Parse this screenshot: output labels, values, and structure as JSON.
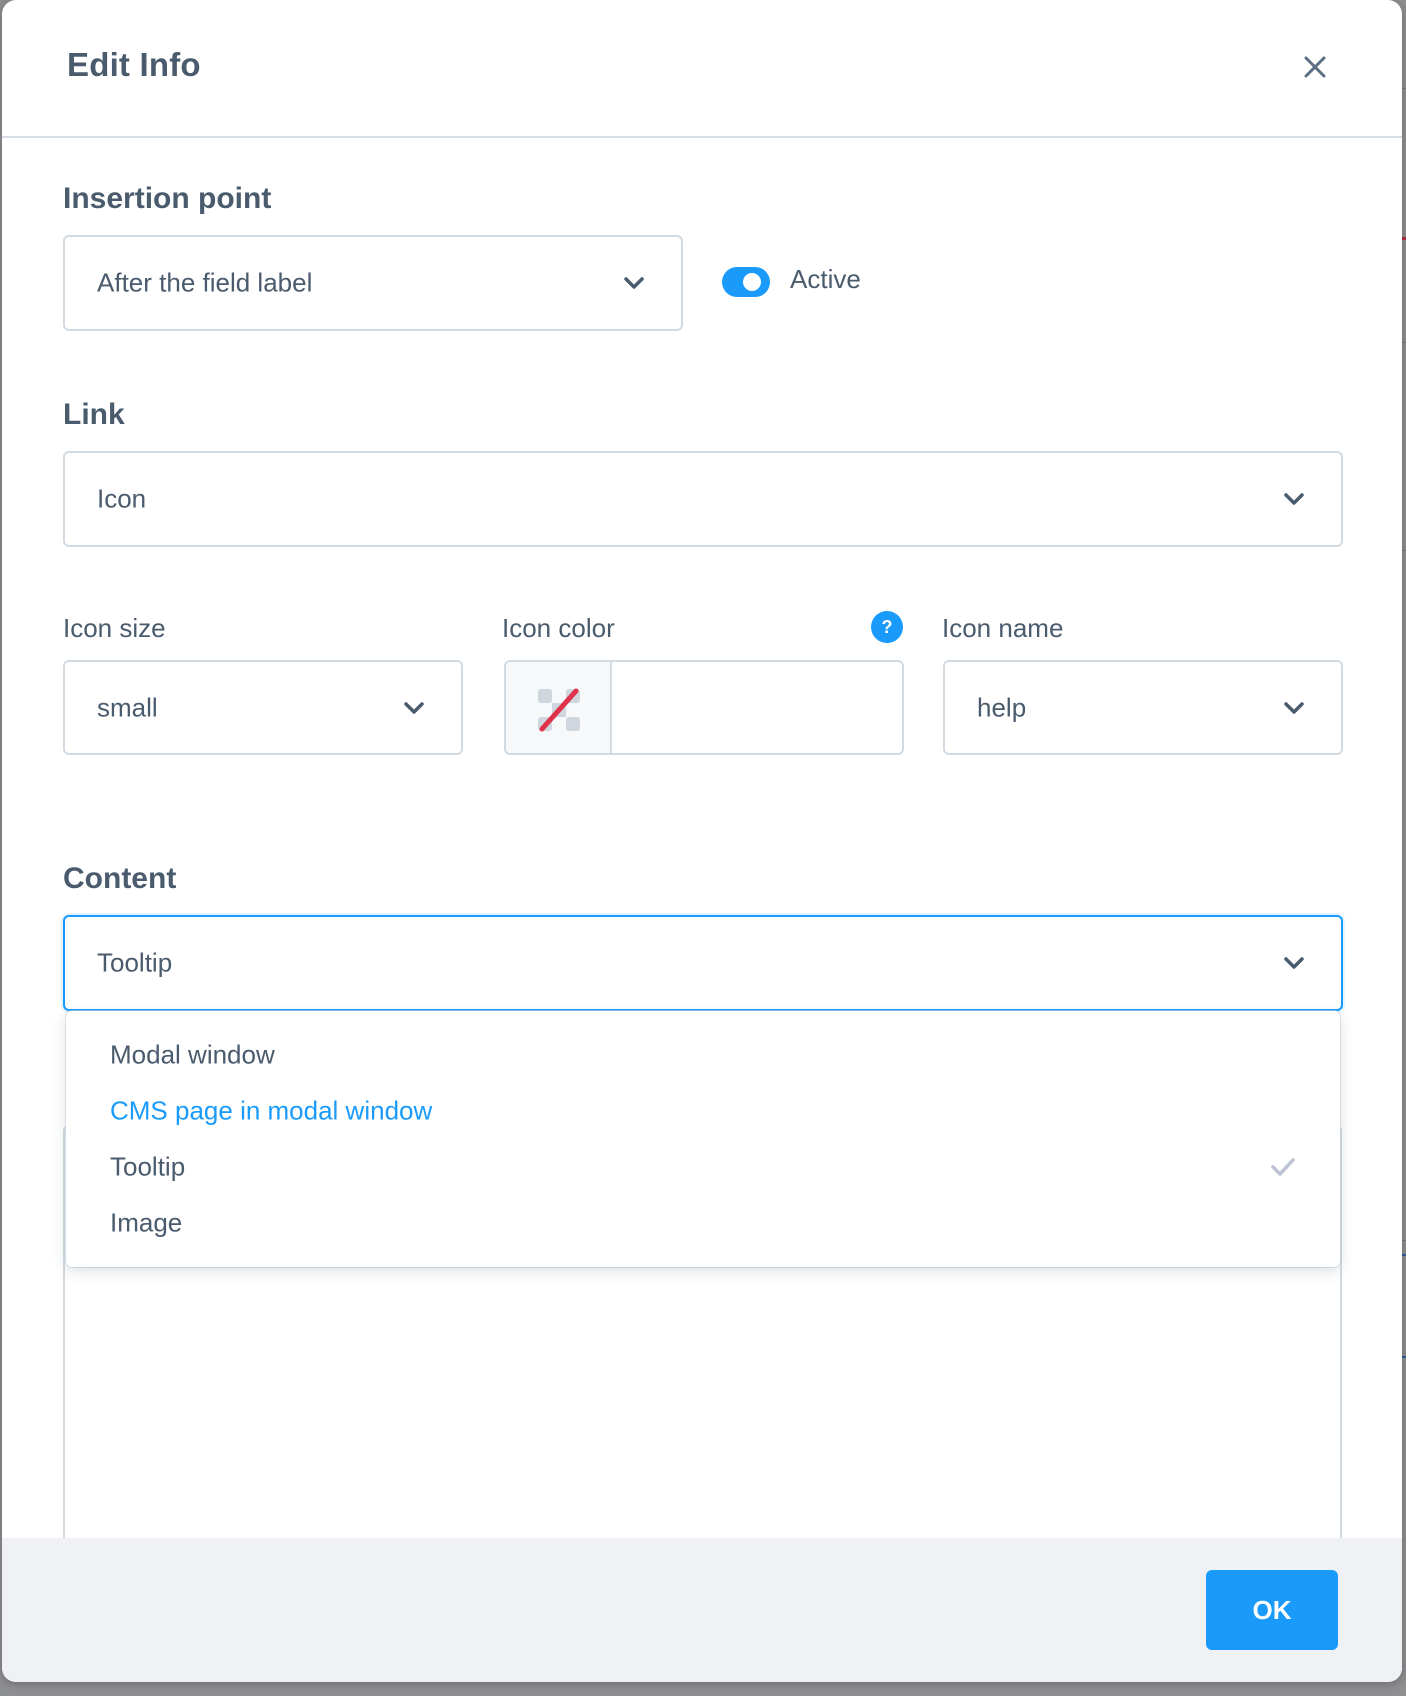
{
  "modal": {
    "title": "Edit Info",
    "close_icon": "close-icon"
  },
  "insertion_point": {
    "label": "Insertion point",
    "value": "After the field label",
    "chevron_icon": "chevron-down-icon"
  },
  "active_toggle": {
    "label": "Active",
    "checked": true
  },
  "link": {
    "label": "Link",
    "value": "Icon",
    "chevron_icon": "chevron-down-icon"
  },
  "icon_size": {
    "label": "Icon size",
    "value": "small"
  },
  "icon_color": {
    "label": "Icon color",
    "value": "",
    "help_icon": "question-circle-icon",
    "help_text": "?",
    "swatch_icon": "no-color-icon"
  },
  "icon_name": {
    "label": "Icon name",
    "value": "help"
  },
  "content": {
    "label": "Content",
    "value": "Tooltip",
    "options": [
      {
        "label": "Modal window",
        "hovered": false,
        "selected": false
      },
      {
        "label": "CMS page in modal window",
        "hovered": true,
        "selected": false
      },
      {
        "label": "Tooltip",
        "hovered": false,
        "selected": true
      },
      {
        "label": "Image",
        "hovered": false,
        "selected": false
      }
    ]
  },
  "footer": {
    "ok_label": "OK"
  },
  "colors": {
    "accent": "#1a9bfc",
    "text": "#4a5b6d",
    "border": "#d3dbe2",
    "footer_bg": "#f0f1f4",
    "swatch_slash": "#e0314b"
  }
}
